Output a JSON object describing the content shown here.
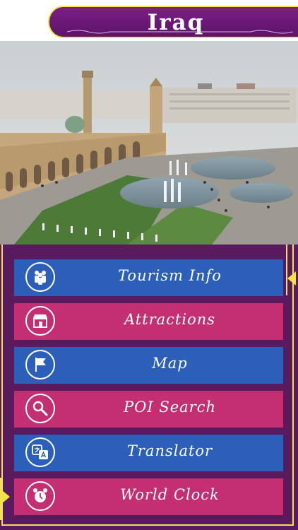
{
  "header": {
    "title": "Iraq"
  },
  "hero": {
    "icon": "city-square-photo"
  },
  "menu": {
    "items": [
      {
        "label": "Tourism Info",
        "icon": "people-icon",
        "color": "#2b5fb9"
      },
      {
        "label": "Attractions",
        "icon": "storefront-icon",
        "color": "#c42f74"
      },
      {
        "label": "Map",
        "icon": "flag-icon",
        "color": "#2b5fb9"
      },
      {
        "label": "POI Search",
        "icon": "magnifier-icon",
        "color": "#c42f74"
      },
      {
        "label": "Translator",
        "icon": "translate-icon",
        "color": "#2b5fb9"
      },
      {
        "label": "World Clock",
        "icon": "alarm-clock-icon",
        "color": "#c42f74"
      }
    ]
  },
  "theme": {
    "panel": "#5a1a5e",
    "accent": "#f2e34a",
    "banner": "#6f1b7b"
  }
}
